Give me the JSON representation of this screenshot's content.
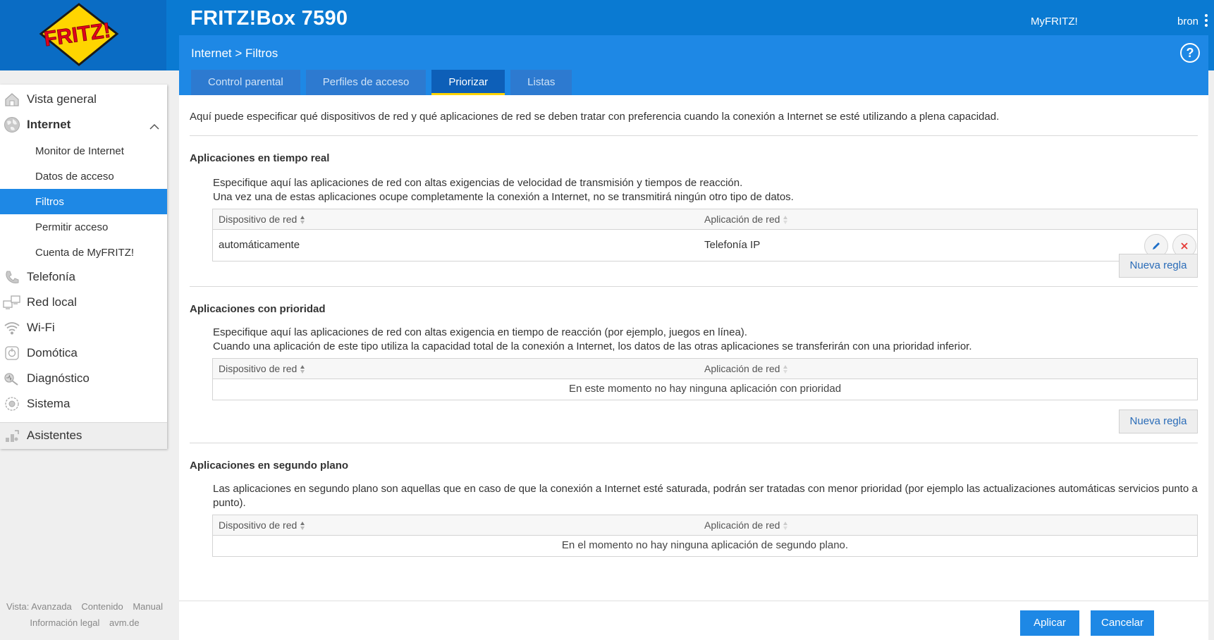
{
  "header": {
    "logo_text": "FRITZ!",
    "product": "FRITZ!Box 7590",
    "myfritz": "MyFRITZ!",
    "user": "bron"
  },
  "breadcrumb": "Internet > Filtros",
  "tabs": [
    {
      "label": "Control parental",
      "active": false
    },
    {
      "label": "Perfiles de acceso",
      "active": false
    },
    {
      "label": "Priorizar",
      "active": true
    },
    {
      "label": "Listas",
      "active": false
    }
  ],
  "sidebar": {
    "items": [
      {
        "label": "Vista general",
        "icon": "home-icon"
      },
      {
        "label": "Internet",
        "icon": "globe-icon"
      },
      {
        "label": "Telefonía",
        "icon": "phone-icon"
      },
      {
        "label": "Red local",
        "icon": "network-icon"
      },
      {
        "label": "Wi-Fi",
        "icon": "wifi-icon"
      },
      {
        "label": "Domótica",
        "icon": "smart-home-icon"
      },
      {
        "label": "Diagnóstico",
        "icon": "diagnostics-icon"
      },
      {
        "label": "Sistema",
        "icon": "system-icon"
      },
      {
        "label": "Asistentes",
        "icon": "wizard-icon"
      }
    ],
    "sub_items": [
      {
        "label": "Monitor de Internet"
      },
      {
        "label": "Datos de acceso"
      },
      {
        "label": "Filtros",
        "active": true
      },
      {
        "label": "Permitir acceso"
      },
      {
        "label": "Cuenta de MyFRITZ!"
      }
    ]
  },
  "footer": {
    "view": "Vista: Avanzada",
    "content": "Contenido",
    "manual": "Manual",
    "legal": "Información legal",
    "site": "avm.de"
  },
  "main": {
    "intro": "Aquí puede especificar qué dispositivos de red y qué aplicaciones de red se deben tratar con preferencia cuando la conexión a Internet se esté utilizando a plena capacidad.",
    "col_device": "Dispositivo de red",
    "col_app": "Aplicación de red",
    "new_rule": "Nueva regla",
    "realtime": {
      "title": "Aplicaciones en tiempo real",
      "desc1": "Especifique aquí las aplicaciones de red con altas exigencias de velocidad de transmisión y tiempos de reacción.",
      "desc2": "Una vez una de estas aplicaciones ocupe completamente la conexión a Internet, no se transmitirá ningún otro tipo de datos.",
      "rows": [
        {
          "device": "automáticamente",
          "app": "Telefonía IP"
        }
      ]
    },
    "priority": {
      "title": "Aplicaciones con prioridad",
      "desc1": "Especifique aquí las aplicaciones de red con altas exigencia en tiempo de reacción (por ejemplo, juegos en línea).",
      "desc2": "Cuando una aplicación de este tipo utiliza la capacidad total de la conexión a Internet, los datos de las otras aplicaciones se transferirán con una prioridad inferior.",
      "empty": "En este momento no hay ninguna aplicación con prioridad"
    },
    "background": {
      "title": "Aplicaciones en segundo plano",
      "desc1": "Las aplicaciones en segundo plano son aquellas que en caso de que la conexión a Internet esté saturada, podrán ser tratadas con menor prioridad (por ejemplo las actualizaciones automáticas servicios punto a",
      "desc2": "punto).",
      "empty": "En el momento no hay ninguna aplicación de segundo plano."
    }
  },
  "actions": {
    "apply": "Aplicar",
    "cancel": "Cancelar"
  },
  "colors": {
    "header_blue": "#0a7ad2",
    "accent_blue": "#1e88e5",
    "tab_active_underline": "#ffd500",
    "delete_red": "#e53935"
  }
}
